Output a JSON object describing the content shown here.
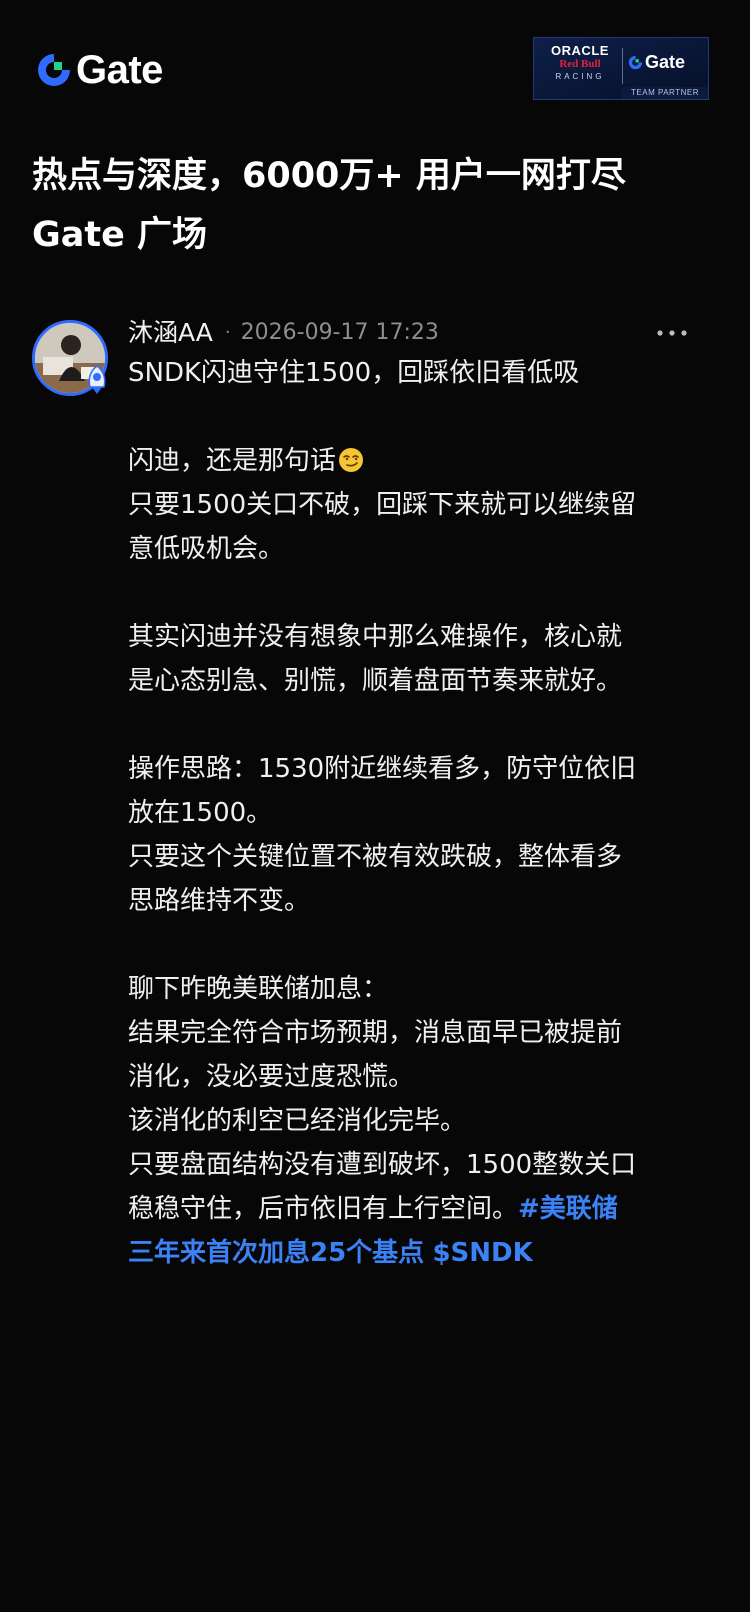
{
  "brand": {
    "logo_text": "Gate",
    "accent_color": "#2f6bff",
    "logo_green": "#1fd48a"
  },
  "partner_badge": {
    "oracle": "ORACLE",
    "redbull": "Red Bull",
    "racing": "RACING",
    "gate": "Gate",
    "footer": "TEAM PARTNER"
  },
  "headline": {
    "line1": "热点与深度，6000万+ 用户一网打尽",
    "line2": "Gate 广场"
  },
  "post": {
    "author": "沐涵AA",
    "separator": "·",
    "timestamp": "2026-09-17 17:23",
    "more_icon": "more-horizontal-icon",
    "lines": [
      "SNDK闪迪守住1500，回踩依旧看低吸",
      "",
      "闪迪，还是那句话",
      "只要1500关口不破，回踩下来就可以继续留",
      "意低吸机会。",
      "",
      "其实闪迪并没有想象中那么难操作，核心就",
      "是心态别急、别慌，顺着盘面节奏来就好。",
      "",
      "操作思路：1530附近继续看多，防守位依旧",
      "放在1500。",
      "只要这个关键位置不被有效跌破，整体看多",
      "思路维持不变。",
      "",
      "聊下昨晚美联储加息：",
      "结果完全符合市场预期，消息面早已被提前",
      "消化，没必要过度恐慌。",
      "该消化的利空已经消化完毕。",
      "只要盘面结构没有遭到破坏，1500整数关口",
      "稳稳守住，后市依旧有上行空间。"
    ],
    "emoji": "smirking-face-icon",
    "hashtag_part1": "#美联储",
    "hashtag_part2": "三年来首次加息25个基点",
    "ticker": "$SNDK",
    "link_color": "#3b82f6"
  }
}
